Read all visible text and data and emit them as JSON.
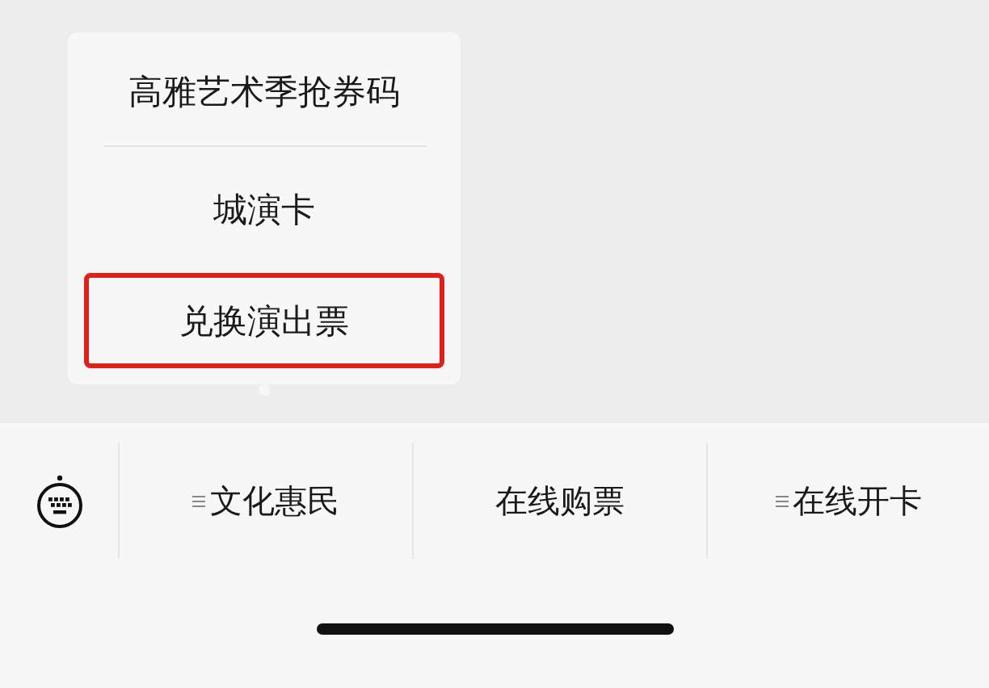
{
  "submenu": {
    "items": [
      {
        "label": "高雅艺术季抢券码",
        "highlighted": false
      },
      {
        "label": "城演卡",
        "highlighted": false
      },
      {
        "label": "兑换演出票",
        "highlighted": true
      }
    ]
  },
  "menu_bar": {
    "items": [
      {
        "label": "文化惠民",
        "has_submenu": true
      },
      {
        "label": "在线购票",
        "has_submenu": false
      },
      {
        "label": "在线开卡",
        "has_submenu": true
      }
    ]
  }
}
